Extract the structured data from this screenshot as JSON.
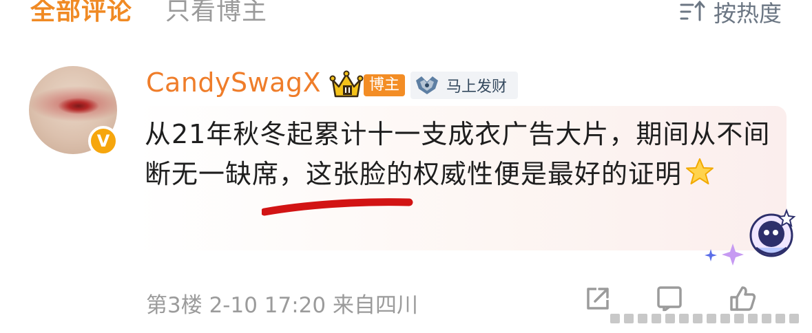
{
  "tabs": {
    "all_comments": "全部评论",
    "blogger_only": "只看博主",
    "sort_label": "按热度"
  },
  "comment": {
    "username": "CandySwagX",
    "badge_label": "博主",
    "medal_label": "马上发财",
    "text": "从21年秋冬起累计十一支成衣广告大片，期间从不间断无一缺席，这张脸的权威性便是最好的证明",
    "verify_symbol": "V",
    "meta": "第3楼 2-10 17:20 来自四川"
  },
  "icons": [
    "sort-icon",
    "crown-icon",
    "medal-icon",
    "star-icon",
    "share-icon",
    "comment-icon",
    "like-icon",
    "mascot-sticker",
    "sparkle-icon"
  ],
  "colors": {
    "accent_orange": "#f08a24",
    "username": "#ef7d2a",
    "verify_badge": "#f6a60d",
    "red_mark": "#d21414",
    "muted_gray": "#9b9b9b"
  }
}
